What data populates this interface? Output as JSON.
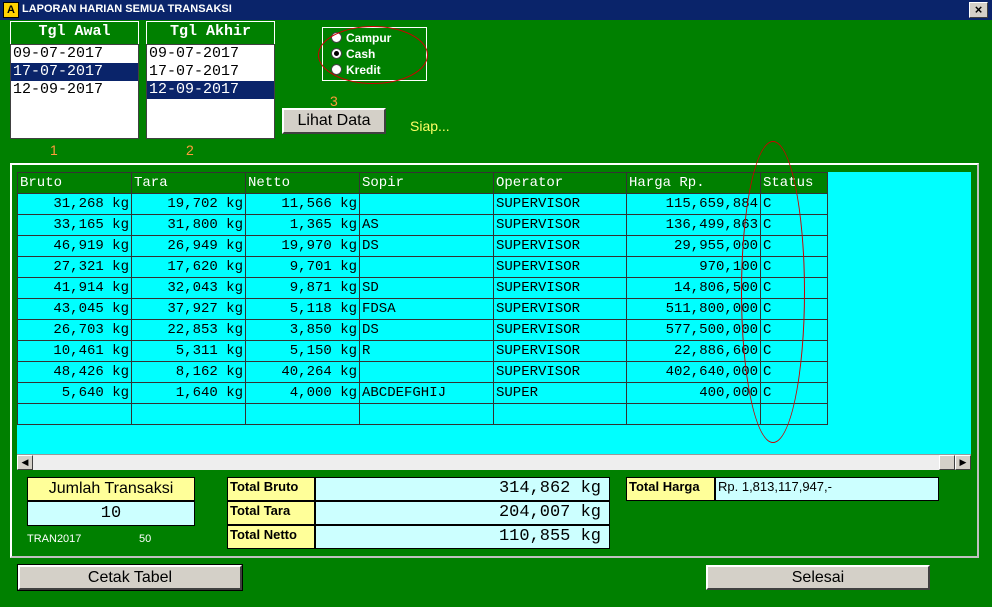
{
  "window": {
    "title": "LAPORAN HARIAN SEMUA TRANSAKSI",
    "icon_letter": "A",
    "close_label": "×",
    "icon_name": "app-icon"
  },
  "tgl_awal": {
    "header": "Tgl Awal",
    "items": [
      "09-07-2017",
      "17-07-2017",
      "12-09-2017"
    ],
    "selected_index": 1
  },
  "tgl_akhir": {
    "header": "Tgl Akhir",
    "items": [
      "09-07-2017",
      "17-07-2017",
      "12-09-2017"
    ],
    "selected_index": 2
  },
  "radio": {
    "options": [
      "Campur",
      "Cash",
      "Kredit"
    ],
    "selected": "Cash"
  },
  "annotations": {
    "a1": "1",
    "a2": "2",
    "a3": "3"
  },
  "lihat_button": "Lihat Data",
  "status_text": "Siap...",
  "table": {
    "columns": [
      "Bruto",
      "Tara",
      "Netto",
      "Sopir",
      "Operator",
      "Harga Rp.",
      "Status"
    ],
    "rows": [
      [
        "31,268 kg",
        "19,702 kg",
        "11,566 kg",
        "",
        "SUPERVISOR",
        "115,659,884",
        "C"
      ],
      [
        "33,165 kg",
        "31,800 kg",
        "1,365 kg",
        "AS",
        "SUPERVISOR",
        "136,499,863",
        "C"
      ],
      [
        "46,919 kg",
        "26,949 kg",
        "19,970 kg",
        "DS",
        "SUPERVISOR",
        "29,955,000",
        "C"
      ],
      [
        "27,321 kg",
        "17,620 kg",
        "9,701 kg",
        "",
        "SUPERVISOR",
        "970,100",
        "C"
      ],
      [
        "41,914 kg",
        "32,043 kg",
        "9,871 kg",
        "SD",
        "SUPERVISOR",
        "14,806,500",
        "C"
      ],
      [
        "43,045 kg",
        "37,927 kg",
        "5,118 kg",
        "FDSA",
        "SUPERVISOR",
        "511,800,000",
        "C"
      ],
      [
        "26,703 kg",
        "22,853 kg",
        "3,850 kg",
        "DS",
        "SUPERVISOR",
        "577,500,000",
        "C"
      ],
      [
        "10,461 kg",
        "5,311 kg",
        "5,150 kg",
        "R",
        "SUPERVISOR",
        "22,886,600",
        "C"
      ],
      [
        "48,426 kg",
        "8,162 kg",
        "40,264 kg",
        "",
        "SUPERVISOR",
        "402,640,000",
        "C"
      ],
      [
        "5,640 kg",
        "1,640 kg",
        "4,000 kg",
        "ABCDEFGHIJ",
        "SUPER",
        "400,000",
        "C"
      ],
      [
        "",
        "",
        "",
        "",
        "",
        "",
        ""
      ]
    ]
  },
  "jumlah": {
    "label": "Jumlah Transaksi",
    "value": "10",
    "code": "TRAN2017",
    "num": "50"
  },
  "totals": {
    "bruto_label": "Total Bruto",
    "bruto_value": "314,862 kg",
    "tara_label": "Total Tara",
    "tara_value": "204,007 kg",
    "netto_label": "Total Netto",
    "netto_value": "110,855 kg",
    "harga_label": "Total Harga",
    "harga_value": "Rp. 1,813,117,947,-"
  },
  "buttons": {
    "cetak": "Cetak Tabel",
    "selesai": "Selesai"
  },
  "colors": {
    "background": "#008000",
    "grid": "#00ffff",
    "label": "#ffff99",
    "value": "#ccffff",
    "annotation": "#ff9a3c",
    "ellipse": "#cc0000"
  }
}
